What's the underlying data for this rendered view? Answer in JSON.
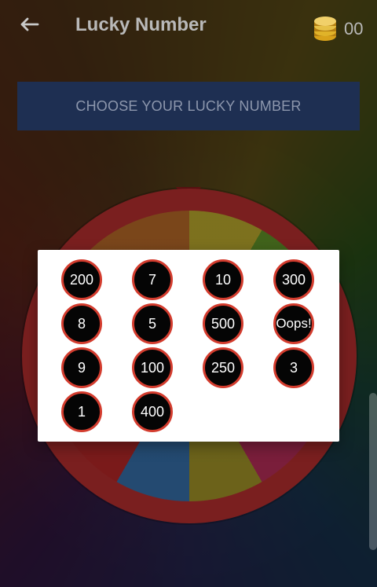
{
  "app_bar": {
    "title": "Lucky Number",
    "coin_count": "00"
  },
  "choose_banner": {
    "label": "CHOOSE YOUR LUCKY NUMBER"
  },
  "dialog": {
    "numbers": [
      "200",
      "7",
      "10",
      "300",
      "8",
      "5",
      "500",
      "Oops!",
      "9",
      "100",
      "250",
      "3",
      "1",
      "400"
    ]
  },
  "icons": {
    "back": "arrow-left-icon",
    "coins": "coins-stack-icon"
  }
}
